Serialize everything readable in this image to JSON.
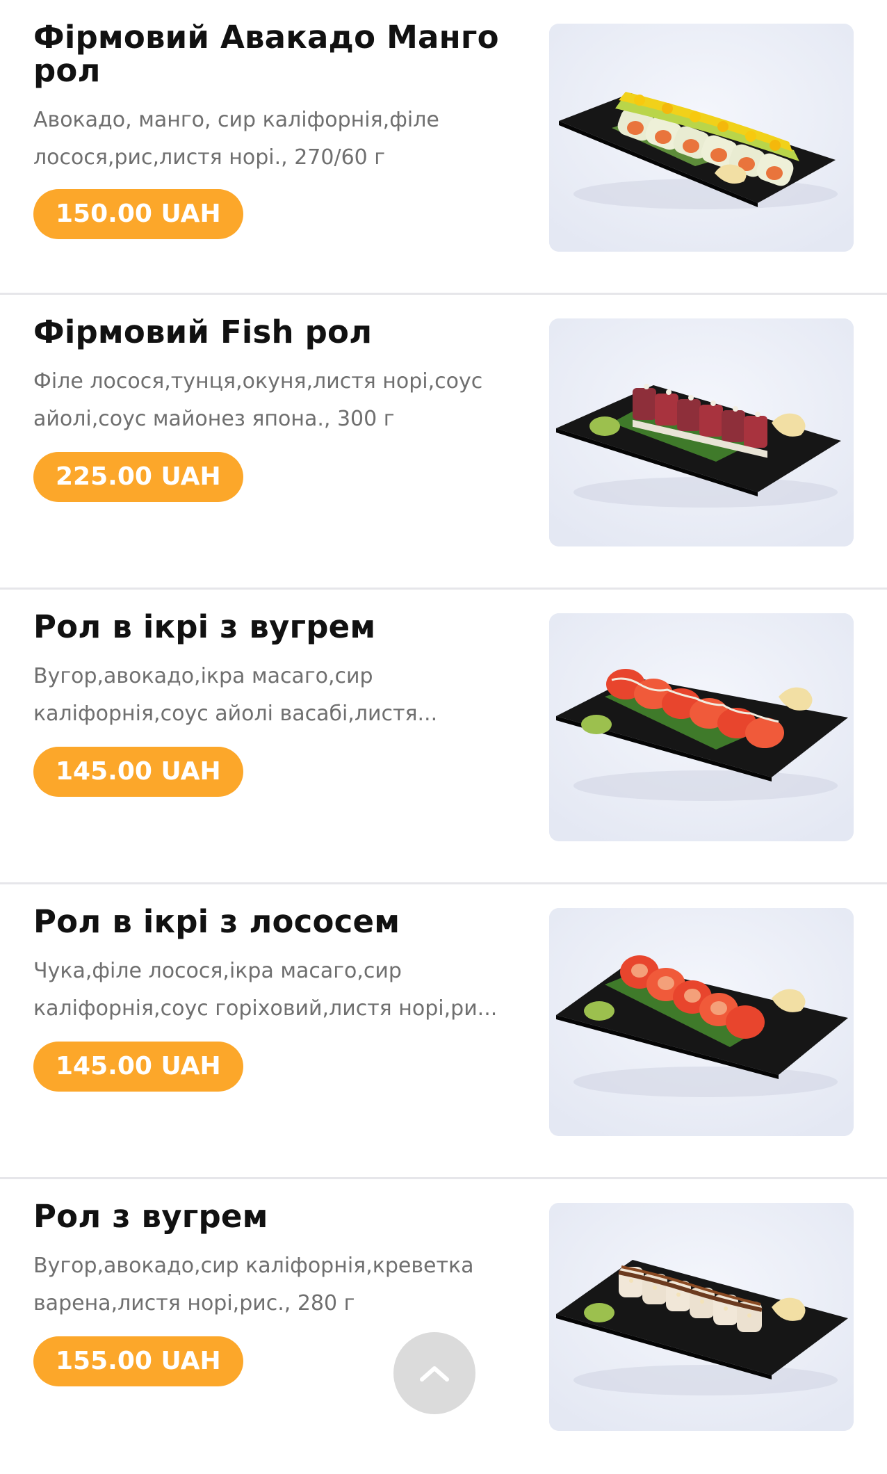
{
  "accent_color": "#fca72a",
  "items": [
    {
      "title": "Фірмовий Авакадо Манго рол",
      "description": "Авокадо, манго, сир каліфорнія,філе лосося,рис,листя норі., 270/60 г",
      "price": "150.00 UAH",
      "image": "avocado-mango-roll-photo"
    },
    {
      "title": "Фірмовий Fish рол",
      "description": "Філе лосося,тунця,окуня,листя норі,соус айолі,соус майонез япона., 300 г",
      "price": "225.00 UAH",
      "image": "fish-roll-photo"
    },
    {
      "title": "Рол в ікрі з вугрем",
      "description": "Вугор,авокадо,ікра масаго,сир каліфорнія,соус айолі васабі,листя...",
      "price": "145.00 UAH",
      "image": "eel-roe-roll-photo"
    },
    {
      "title": "Рол в ікрі з лососем",
      "description": "Чука,філе лосося,ікра масаго,сир каліфорнія,соус горіховий,листя норі,ри...",
      "price": "145.00 UAH",
      "image": "salmon-roe-roll-photo"
    },
    {
      "title": "Рол з вугрем",
      "description": "Вугор,авокадо,сир каліфорнія,креветка варена,листя норі,рис., 280 г",
      "price": "155.00 UAH",
      "image": "eel-roll-photo"
    }
  ],
  "scroll_top": {
    "icon": "chevron-up-icon"
  }
}
